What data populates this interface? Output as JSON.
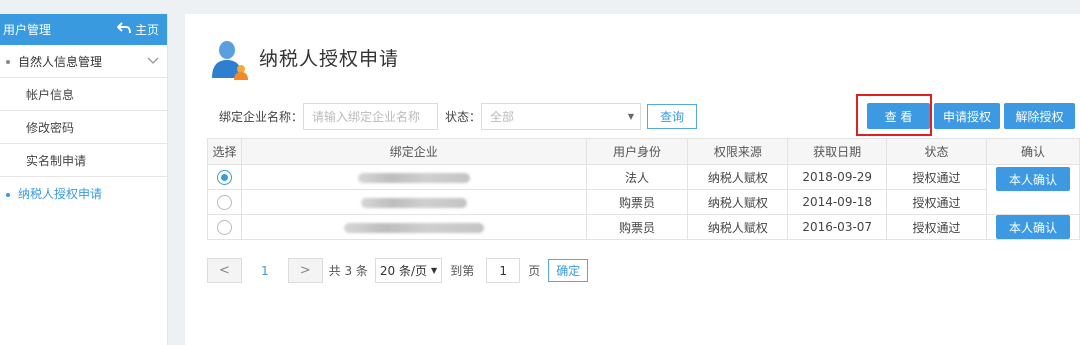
{
  "sidebar": {
    "header_title": "用户管理",
    "home_label": "主页",
    "parent_label": "自然人信息管理",
    "children": [
      "帐户信息",
      "修改密码",
      "实名制申请"
    ],
    "active_label": "纳税人授权申请"
  },
  "main": {
    "title": "纳税人授权申请",
    "filter": {
      "company_label": "绑定企业名称：",
      "company_placeholder": "请输入绑定企业名称",
      "status_label": "状态：",
      "status_value": "全部",
      "query_label": "查询"
    },
    "actions": {
      "view_label": "查 看",
      "apply_label": "申请授权",
      "revoke_label": "解除授权"
    },
    "table": {
      "headers": [
        "选择",
        "绑定企业",
        "用户身份",
        "权限来源",
        "获取日期",
        "状态",
        "确认"
      ],
      "rows": [
        {
          "selected": true,
          "identity": "法人",
          "source": "纳税人赋权",
          "date": "2018-09-29",
          "status": "授权通过",
          "confirm": "本人确认"
        },
        {
          "selected": false,
          "identity": "购票员",
          "source": "纳税人赋权",
          "date": "2014-09-18",
          "status": "授权通过",
          "confirm": ""
        },
        {
          "selected": false,
          "identity": "购票员",
          "source": "纳税人赋权",
          "date": "2016-03-07",
          "status": "授权通过",
          "confirm": "本人确认"
        }
      ]
    },
    "pagination": {
      "prev": "<",
      "current_page": "1",
      "next": ">",
      "total": "共 3 条",
      "page_size": "20 条/页",
      "goto_label": "到第",
      "goto_value": "1",
      "page_unit": "页",
      "ok_label": "确定"
    }
  },
  "colors": {
    "accent": "#3a9ae0",
    "highlight_border": "#e02020"
  }
}
